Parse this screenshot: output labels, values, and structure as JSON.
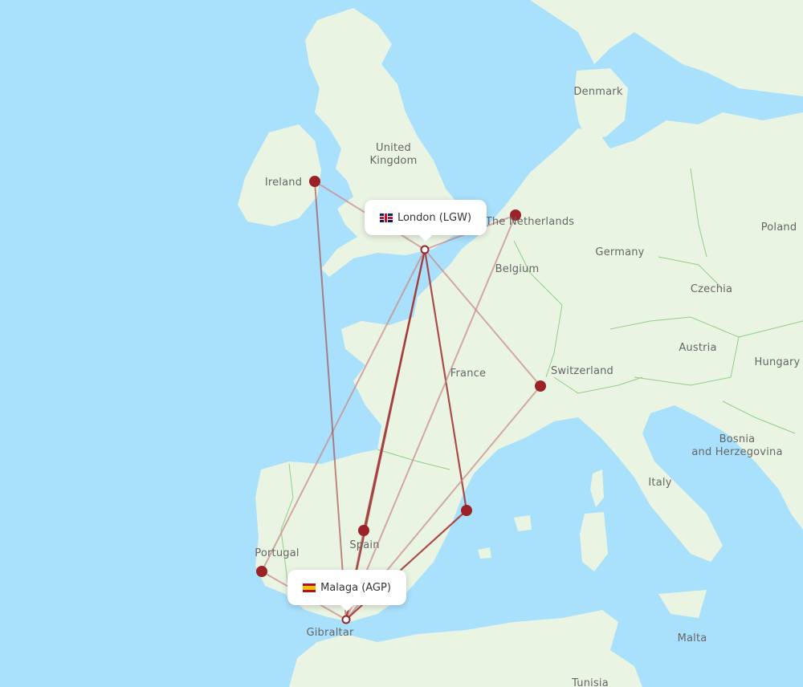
{
  "map": {
    "colors": {
      "water": "#a9e0fc",
      "land": "#eaf4e2",
      "border": "#8fcf8a",
      "route": "#a33a3a",
      "route_faint": "#c98d8d",
      "marker": "#9b2226"
    },
    "origin": {
      "label": "London (LGW)",
      "flag_icon": "uk-flag-icon",
      "marker": "hollow"
    },
    "destination": {
      "label": "Malaga (AGP)",
      "flag_icon": "spain-flag-icon",
      "marker": "hollow"
    },
    "country_labels": [
      {
        "name": "Denmark"
      },
      {
        "name": "United Kingdom"
      },
      {
        "name": "Ireland"
      },
      {
        "name": "The Netherlands"
      },
      {
        "name": "Poland"
      },
      {
        "name": "Germany"
      },
      {
        "name": "Belgium"
      },
      {
        "name": "Czechia"
      },
      {
        "name": "Austria"
      },
      {
        "name": "Hungary"
      },
      {
        "name": "France"
      },
      {
        "name": "Switzerland"
      },
      {
        "name": "Bosnia and Herzegovina"
      },
      {
        "name": "Italy"
      },
      {
        "name": "Spain"
      },
      {
        "name": "Portugal"
      },
      {
        "name": "Gibraltar"
      },
      {
        "name": "Malta"
      },
      {
        "name": "Tunisia"
      }
    ],
    "waypoints": [
      {
        "id": "dublin",
        "name": "Dublin (Ireland)"
      },
      {
        "id": "amsterdam",
        "name": "Amsterdam (The Netherlands)"
      },
      {
        "id": "geneva",
        "name": "Geneva (Switzerland)"
      },
      {
        "id": "madrid",
        "name": "Madrid (Spain)"
      },
      {
        "id": "valencia",
        "name": "Valencia (Spain)"
      },
      {
        "id": "lisbon",
        "name": "Lisbon (Portugal)"
      }
    ],
    "routes": [
      {
        "from": "london",
        "to": "malaga",
        "strength": "strong"
      },
      {
        "from": "london",
        "to": "madrid",
        "strength": "strong"
      },
      {
        "from": "london",
        "to": "valencia",
        "strength": "strong"
      },
      {
        "from": "london",
        "to": "dublin",
        "strength": "faint"
      },
      {
        "from": "london",
        "to": "amsterdam",
        "strength": "faint"
      },
      {
        "from": "london",
        "to": "geneva",
        "strength": "faint"
      },
      {
        "from": "london",
        "to": "lisbon",
        "strength": "faint"
      },
      {
        "from": "malaga",
        "to": "dublin",
        "strength": "medium"
      },
      {
        "from": "malaga",
        "to": "amsterdam",
        "strength": "faint"
      },
      {
        "from": "malaga",
        "to": "geneva",
        "strength": "faint"
      },
      {
        "from": "malaga",
        "to": "madrid",
        "strength": "medium"
      },
      {
        "from": "malaga",
        "to": "valencia",
        "strength": "strong"
      },
      {
        "from": "malaga",
        "to": "lisbon",
        "strength": "faint"
      }
    ]
  }
}
